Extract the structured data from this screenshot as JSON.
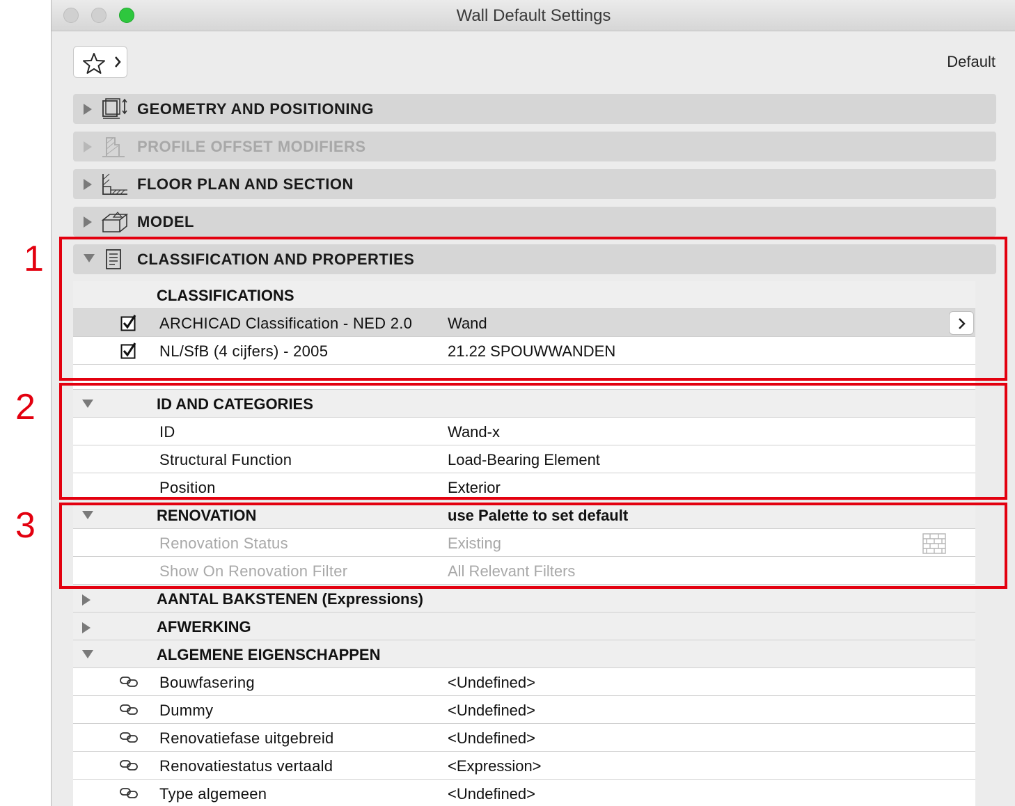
{
  "window": {
    "title": "Wall Default Settings"
  },
  "header": {
    "favorites_label": "",
    "default_label": "Default"
  },
  "panels": [
    {
      "label": "GEOMETRY AND POSITIONING",
      "icon": "geometry-icon",
      "state": "collapsed"
    },
    {
      "label": "PROFILE OFFSET MODIFIERS",
      "icon": "profile-icon",
      "state": "disabled"
    },
    {
      "label": "FLOOR PLAN AND SECTION",
      "icon": "floor-plan-icon",
      "state": "collapsed"
    },
    {
      "label": "MODEL",
      "icon": "model-icon",
      "state": "collapsed"
    },
    {
      "label": "CLASSIFICATION AND PROPERTIES",
      "icon": "document-icon",
      "state": "expanded"
    }
  ],
  "classifications": {
    "header": "CLASSIFICATIONS",
    "rows": [
      {
        "checked": true,
        "name": "ARCHICAD Classification - NED 2.0",
        "value": "Wand"
      },
      {
        "checked": true,
        "name": "NL/SfB (4 cijfers) - 2005",
        "value": "21.22 SPOUWWANDEN"
      }
    ]
  },
  "id_categories": {
    "header": "ID AND CATEGORIES",
    "rows": [
      {
        "name": "ID",
        "value": "Wand-x"
      },
      {
        "name": "Structural Function",
        "value": "Load-Bearing Element"
      },
      {
        "name": "Position",
        "value": "Exterior"
      }
    ]
  },
  "renovation": {
    "header": "RENOVATION",
    "header_value": "use Palette to set default",
    "rows": [
      {
        "name": "Renovation Status",
        "value": "Existing"
      },
      {
        "name": "Show On Renovation Filter",
        "value": "All Relevant Filters"
      }
    ]
  },
  "groups": [
    {
      "header": "AANTAL BAKSTENEN (Expressions)",
      "state": "collapsed"
    },
    {
      "header": "AFWERKING",
      "state": "collapsed"
    },
    {
      "header": "ALGEMENE EIGENSCHAPPEN",
      "state": "expanded"
    }
  ],
  "properties": [
    {
      "name": "Bouwfasering",
      "value": "<Undefined>"
    },
    {
      "name": "Dummy",
      "value": "<Undefined>"
    },
    {
      "name": "Renovatiefase uitgebreid",
      "value": "<Undefined>"
    },
    {
      "name": "Renovatiestatus vertaald",
      "value": "<Expression>"
    },
    {
      "name": "Type algemeen",
      "value": "<Undefined>"
    }
  ],
  "annotations": [
    "1",
    "2",
    "3"
  ],
  "colors": {
    "highlight": "#e3000f",
    "zoom_button": "#2ec73e"
  }
}
